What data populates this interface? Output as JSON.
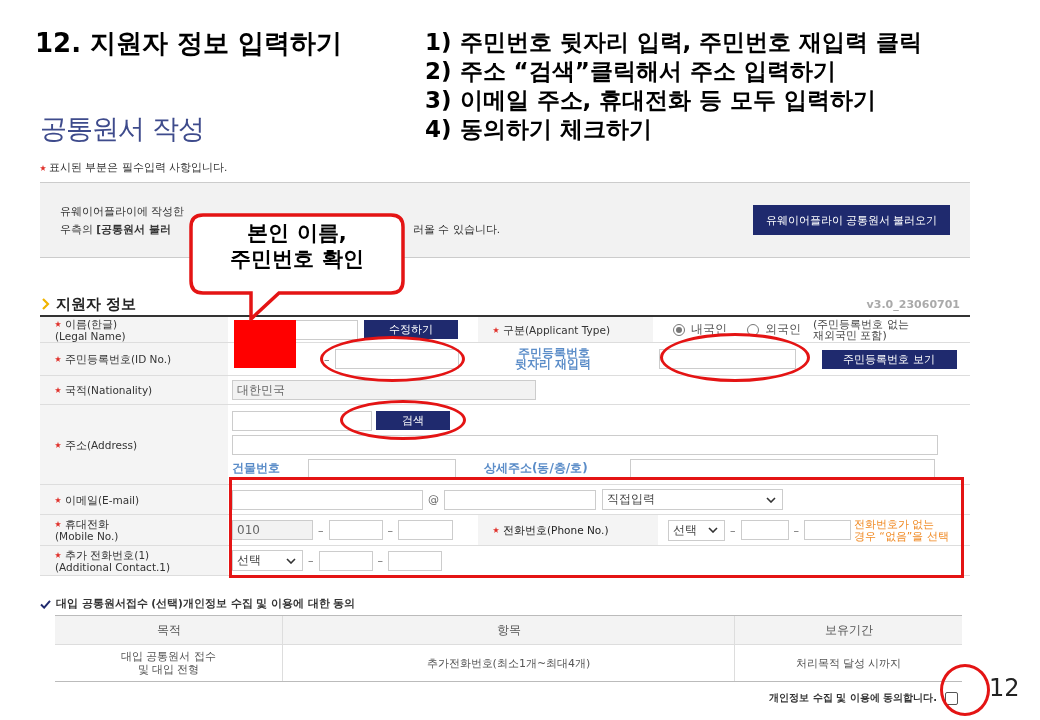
{
  "slide": {
    "title": "12. 지원자 정보 입력하기",
    "steps": [
      "1) 주민번호 뒷자리 입력, 주민번호 재입력 클릭",
      "2) 주소 “검색”클릭해서 주소 입력하기",
      "3) 이메일 주소, 휴대전화 등 모두 입력하기",
      "4) 동의하기 체크하기"
    ],
    "page_number": "12"
  },
  "callout": {
    "text": "본인 이름,\n주민번호 확인"
  },
  "form": {
    "title": "공통원서 작성",
    "required_note": "표시된 부분은 필수입력 사항입니다.",
    "info": {
      "line_1": "유웨이어플라이에 작성한",
      "line_2a": "우측의 **[공통원서 불러**",
      "line_2b": "러올 수 있습니다.",
      "button": "유웨이어플라이 공통원서 불러오기"
    },
    "section": {
      "title": "지원자 정보",
      "version": "v3.0_23060701"
    }
  },
  "applicant": {
    "name": {
      "label": "이름(한글)",
      "sublabel": "(Legal Name)",
      "required": true,
      "button": "수정하기"
    },
    "type": {
      "label": "구분(Applicant Type)",
      "required": true,
      "options": [
        {
          "label": "내국인",
          "selected": true
        },
        {
          "label": "외국인",
          "selected": false
        }
      ],
      "note": "(주민등록번호 없는\n재외국민 포함)"
    },
    "id": {
      "label": "주민등록번호(ID No.)",
      "required": true,
      "separator": "–",
      "confirm_label": "주민등록번호\n뒷자리 재입력",
      "button": "주민등록번호 보기"
    },
    "nationality": {
      "label": "국적(Nationality)",
      "required": true,
      "value": "대한민국"
    },
    "address": {
      "label": "주소(Address)",
      "required": true,
      "button": "검색",
      "building_label": "건물번호",
      "detail_label": "상세주소(동/층/호)"
    },
    "email": {
      "label": "이메일(E-mail)",
      "required": true,
      "at": "@",
      "domain_select": "직접입력"
    },
    "mobile": {
      "label": "휴대전화",
      "sublabel": "(Mobile No.)",
      "required": true,
      "prefix": "010",
      "separators": [
        "–",
        "–"
      ]
    },
    "phone": {
      "label": "전화번호(Phone No.)",
      "required": true,
      "select": "선택",
      "separators": [
        "–",
        "–"
      ],
      "note": "전화번호가 없는\n경우 “없음”을 선택"
    },
    "additional": {
      "label": "추가 전화번호(1)",
      "sublabel": "(Additional Contact.1)",
      "required": true,
      "select": "선택",
      "separators": [
        "–",
        "–"
      ]
    }
  },
  "consent": {
    "title": "대입 공통원서접수 (선택)개인정보 수집 및 이용에 대한 동의",
    "columns": [
      "목적",
      "항목",
      "보유기간"
    ],
    "rows": [
      [
        "대입 공통원서 접수\n및 대입 전형",
        "추가전화번호(최소1개~최대4개)",
        "처리목적 달성 시까지"
      ]
    ],
    "agree_label": "개인정보 수집 및 이용에 동의합니다.",
    "agreed": false
  }
}
